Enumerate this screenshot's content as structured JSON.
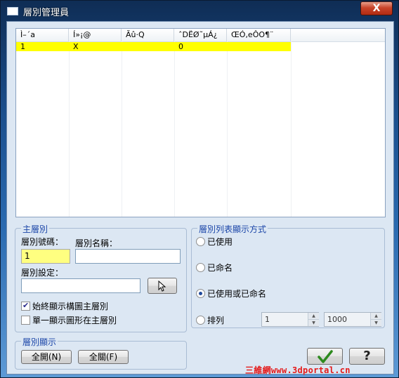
{
  "window": {
    "title": "層別管理員",
    "close_label": "X"
  },
  "listview": {
    "columns": [
      "Ì–´a",
      "Í»¡@",
      "Ãû·Q",
      "ˆDËØ˜µÁ¿",
      "ŒÓ‚eÔO¶¨"
    ],
    "rows": [
      [
        "1",
        "X",
        "",
        "0",
        ""
      ]
    ],
    "selected_row_color": "#ffff00"
  },
  "main_layer": {
    "title": "主層別",
    "number_label": "層別號碼：",
    "number_value": "1",
    "name_label": "層別名稱：",
    "name_value": "",
    "setting_label": "層別設定：",
    "setting_value": "",
    "always_show_label": "始終顯示構圖主層別",
    "always_show_checked": true,
    "single_show_label": "單一顯示圖形在主層別",
    "single_show_checked": false
  },
  "display_mode": {
    "title": "層別列表顯示方式",
    "options": [
      "已使用",
      "已命名",
      "已使用或已命名",
      "排列"
    ],
    "selected": "已使用或已命名",
    "range_from": "1",
    "range_to": "1000"
  },
  "layer_display": {
    "title": "層別顯示",
    "all_on": "全開(N)",
    "all_off": "全關(F)"
  },
  "watermark": "三維網www.3dportal.cn",
  "colors": {
    "ok_check": "#2d8a1e",
    "accent": "#1a45a8"
  }
}
